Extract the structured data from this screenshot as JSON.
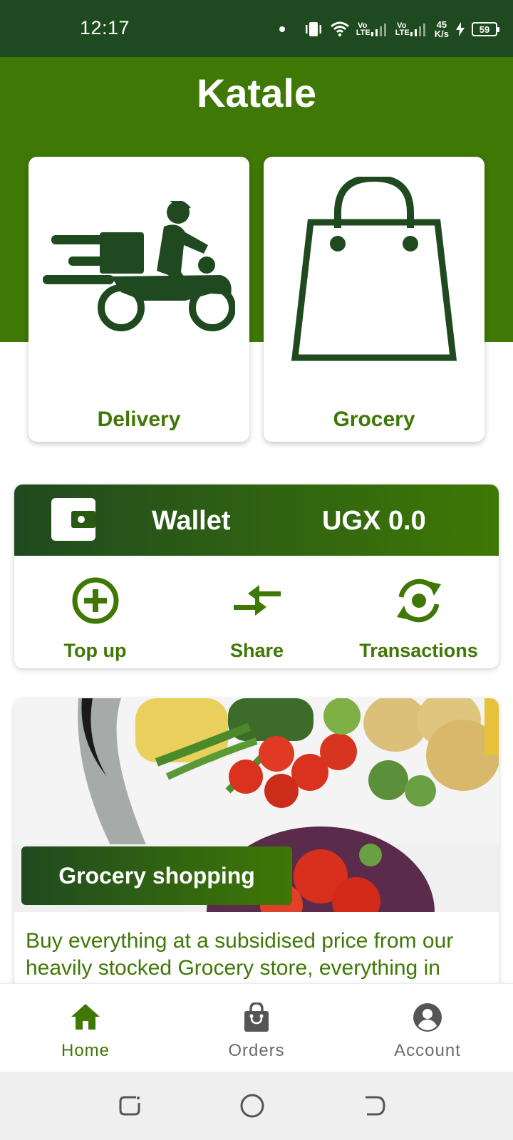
{
  "status_bar": {
    "time": "12:17",
    "lte1": "Vo LTE",
    "lte2": "Vo LTE",
    "net_speed_value": "45",
    "net_speed_unit": "K/s",
    "battery": "59"
  },
  "header": {
    "title": "Katale"
  },
  "services": [
    {
      "label": "Delivery",
      "icon": "delivery-scooter-icon"
    },
    {
      "label": "Grocery",
      "icon": "shopping-bag-icon"
    }
  ],
  "wallet": {
    "title": "Wallet",
    "balance": "UGX 0.0",
    "icon": "wallet-icon",
    "actions": [
      {
        "label": "Top up",
        "icon": "add-circle-icon"
      },
      {
        "label": "Share",
        "icon": "swap-arrows-icon"
      },
      {
        "label": "Transactions",
        "icon": "refresh-cycle-icon"
      }
    ]
  },
  "promo": {
    "badge": "Grocery shopping",
    "description": "Buy everything at a subsidised price from our heavily stocked Grocery store, everything in"
  },
  "bottom_nav": [
    {
      "label": "Home",
      "icon": "home-icon",
      "active": true
    },
    {
      "label": "Orders",
      "icon": "shopping-bag-icon",
      "active": false
    },
    {
      "label": "Account",
      "icon": "account-circle-icon",
      "active": false
    }
  ],
  "colors": {
    "primary": "#3f7805",
    "dark": "#1f4a1f",
    "inactive": "#6b6b6b"
  }
}
